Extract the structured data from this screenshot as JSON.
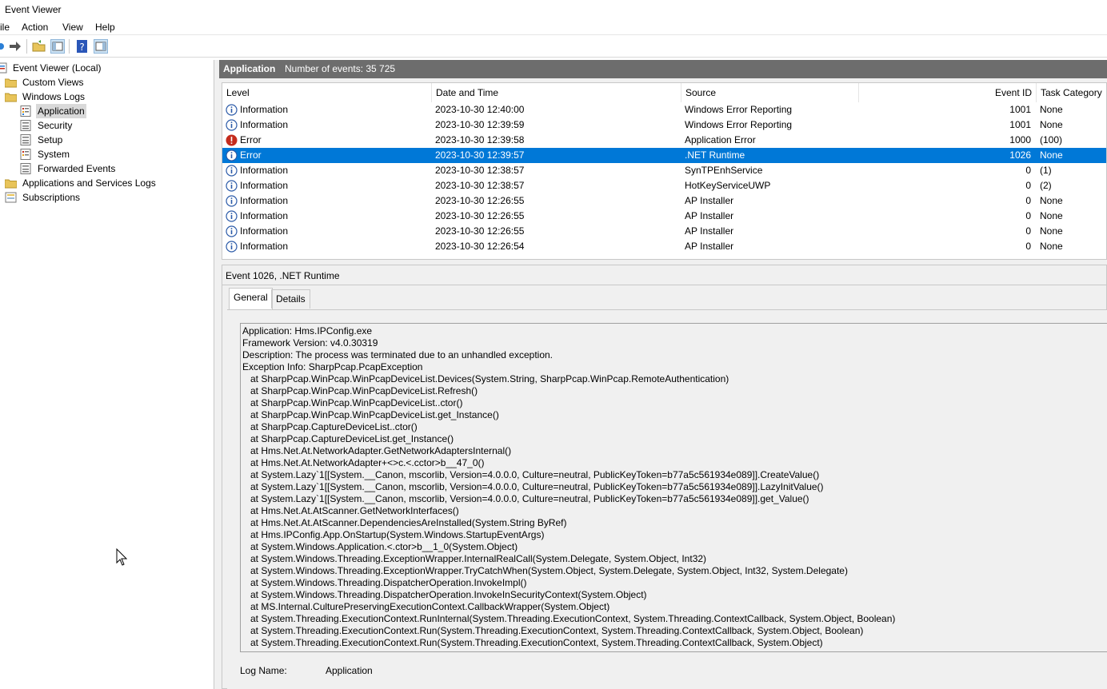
{
  "window": {
    "title": "Event Viewer"
  },
  "menu": [
    "ile",
    "Action",
    "View",
    "Help"
  ],
  "tree": {
    "items": [
      {
        "label": "Event Viewer (Local)",
        "icon": "event-viewer-icon"
      },
      {
        "label": "Custom Views",
        "icon": "folder-icon"
      },
      {
        "label": "Windows Logs",
        "icon": "folder-icon"
      },
      {
        "label": "Application",
        "icon": "log-icon"
      },
      {
        "label": "Security",
        "icon": "log-icon"
      },
      {
        "label": "Setup",
        "icon": "log-icon"
      },
      {
        "label": "System",
        "icon": "log-icon"
      },
      {
        "label": "Forwarded Events",
        "icon": "log-icon"
      },
      {
        "label": "Applications and Services Logs",
        "icon": "folder-icon"
      },
      {
        "label": "Subscriptions",
        "icon": "subscriptions-icon"
      }
    ]
  },
  "pane": {
    "name": "Application",
    "count": "Number of events: 35 725"
  },
  "grid": {
    "columns": [
      "Level",
      "Date and Time",
      "Source",
      "Event ID",
      "Task Category"
    ],
    "rows": [
      [
        "Information",
        "2023-10-30 12:40:00",
        "Windows Error Reporting",
        "1001",
        "None"
      ],
      [
        "Information",
        "2023-10-30 12:39:59",
        "Windows Error Reporting",
        "1001",
        "None"
      ],
      [
        "Error",
        "2023-10-30 12:39:58",
        "Application Error",
        "1000",
        "(100)"
      ],
      [
        "Error",
        "2023-10-30 12:39:57",
        ".NET Runtime",
        "1026",
        "None"
      ],
      [
        "Information",
        "2023-10-30 12:38:57",
        "SynTPEnhService",
        "0",
        "(1)"
      ],
      [
        "Information",
        "2023-10-30 12:38:57",
        "HotKeyServiceUWP",
        "0",
        "(2)"
      ],
      [
        "Information",
        "2023-10-30 12:26:55",
        "AP Installer",
        "0",
        "None"
      ],
      [
        "Information",
        "2023-10-30 12:26:55",
        "AP Installer",
        "0",
        "None"
      ],
      [
        "Information",
        "2023-10-30 12:26:55",
        "AP Installer",
        "0",
        "None"
      ],
      [
        "Information",
        "2023-10-30 12:26:54",
        "AP Installer",
        "0",
        "None"
      ]
    ]
  },
  "detail": {
    "title": "Event 1026, .NET Runtime",
    "tabs": [
      "General",
      "Details"
    ],
    "description": [
      "Application: Hms.IPConfig.exe",
      "Framework Version: v4.0.30319",
      "Description: The process was terminated due to an unhandled exception.",
      "Exception Info: SharpPcap.PcapException",
      "   at SharpPcap.WinPcap.WinPcapDeviceList.Devices(System.String, SharpPcap.WinPcap.RemoteAuthentication)",
      "   at SharpPcap.WinPcap.WinPcapDeviceList.Refresh()",
      "   at SharpPcap.WinPcap.WinPcapDeviceList..ctor()",
      "   at SharpPcap.WinPcap.WinPcapDeviceList.get_Instance()",
      "   at SharpPcap.CaptureDeviceList..ctor()",
      "   at SharpPcap.CaptureDeviceList.get_Instance()",
      "   at Hms.Net.At.NetworkAdapter.GetNetworkAdaptersInternal()",
      "   at Hms.Net.At.NetworkAdapter+<>c.<.cctor>b__47_0()",
      "   at System.Lazy`1[[System.__Canon, mscorlib, Version=4.0.0.0, Culture=neutral, PublicKeyToken=b77a5c561934e089]].CreateValue()",
      "   at System.Lazy`1[[System.__Canon, mscorlib, Version=4.0.0.0, Culture=neutral, PublicKeyToken=b77a5c561934e089]].LazyInitValue()",
      "   at System.Lazy`1[[System.__Canon, mscorlib, Version=4.0.0.0, Culture=neutral, PublicKeyToken=b77a5c561934e089]].get_Value()",
      "   at Hms.Net.At.AtScanner.GetNetworkInterfaces()",
      "   at Hms.Net.At.AtScanner.DependenciesAreInstalled(System.String ByRef)",
      "   at Hms.IPConfig.App.OnStartup(System.Windows.StartupEventArgs)",
      "   at System.Windows.Application.<.ctor>b__1_0(System.Object)",
      "   at System.Windows.Threading.ExceptionWrapper.InternalRealCall(System.Delegate, System.Object, Int32)",
      "   at System.Windows.Threading.ExceptionWrapper.TryCatchWhen(System.Object, System.Delegate, System.Object, Int32, System.Delegate)",
      "   at System.Windows.Threading.DispatcherOperation.InvokeImpl()",
      "   at System.Windows.Threading.DispatcherOperation.InvokeInSecurityContext(System.Object)",
      "   at MS.Internal.CulturePreservingExecutionContext.CallbackWrapper(System.Object)",
      "   at System.Threading.ExecutionContext.RunInternal(System.Threading.ExecutionContext, System.Threading.ContextCallback, System.Object, Boolean)",
      "   at System.Threading.ExecutionContext.Run(System.Threading.ExecutionContext, System.Threading.ContextCallback, System.Object, Boolean)",
      "   at System.Threading.ExecutionContext.Run(System.Threading.ExecutionContext, System.Threading.ContextCallback, System.Object)"
    ],
    "fields": {
      "log_name_label": "Log Name:",
      "log_name_value": "Application"
    }
  },
  "colors": {
    "selection": "#0078d7",
    "header_bar": "#6d6d6d",
    "error": "#c42b1c",
    "info": "#2b5aa8"
  }
}
